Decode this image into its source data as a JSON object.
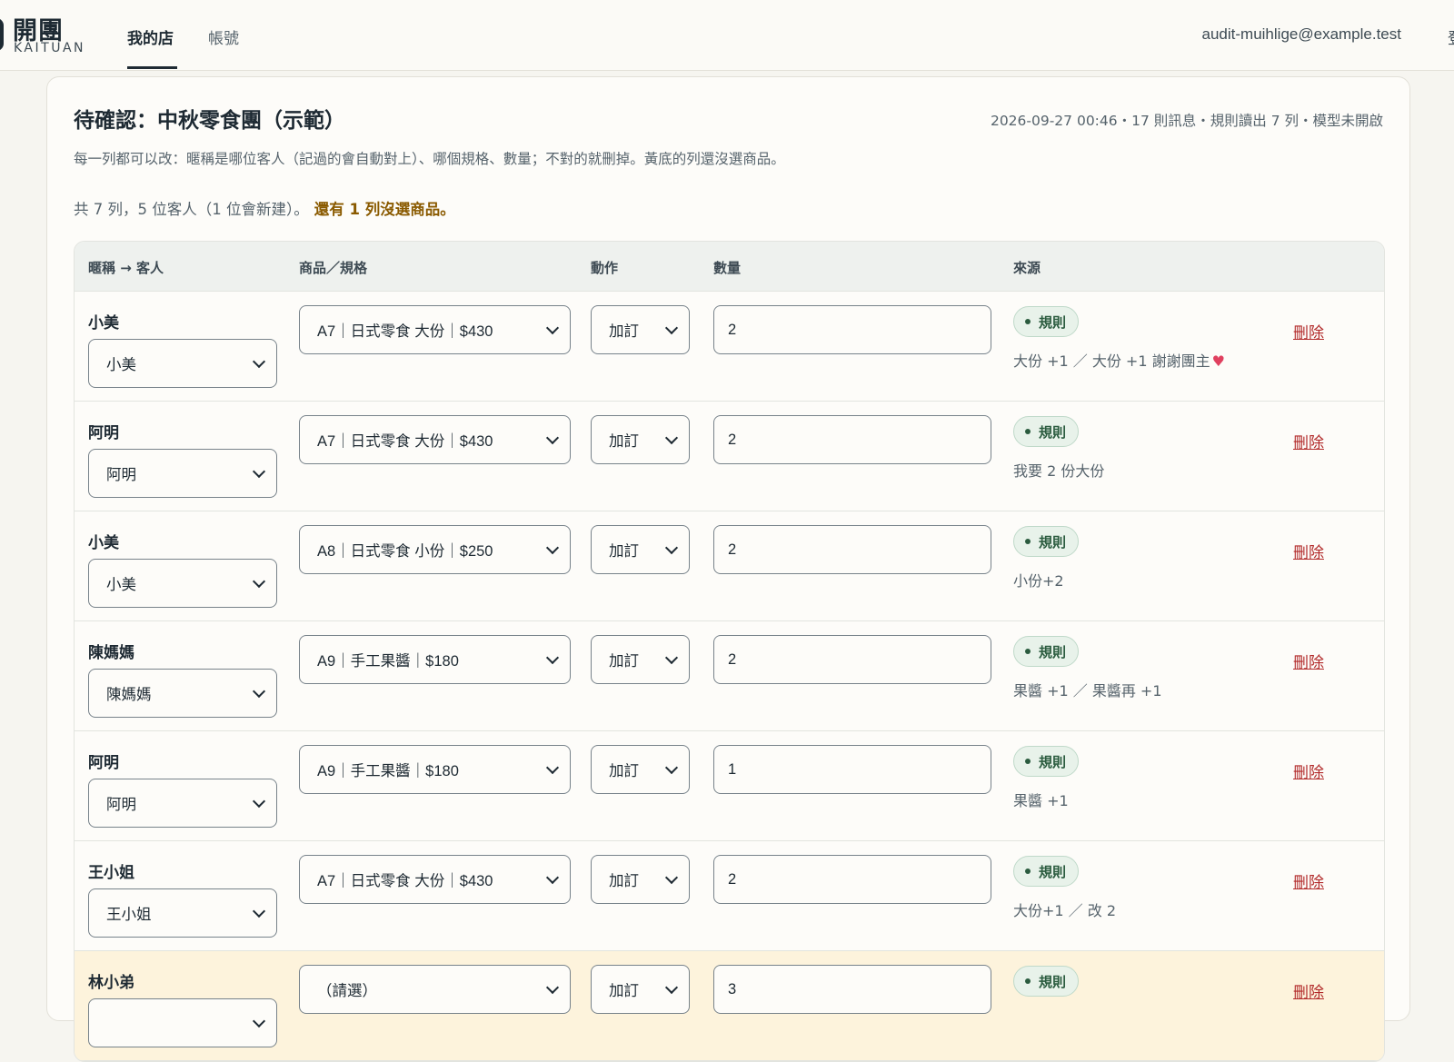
{
  "app": {
    "logo_title": "開團",
    "logo_subtitle": "KAITUAN",
    "nav": [
      {
        "label": "我的店",
        "active": true
      },
      {
        "label": "帳號",
        "active": false
      }
    ],
    "user_email": "audit-muihlige@example.test",
    "user_email_overflow": "登"
  },
  "page": {
    "title": "待確認：中秋零食團（示範）",
    "meta": "2026-09-27 00:46・17 則訊息・規則讀出 7 列・模型未開啟",
    "description": "每一列都可以改：暱稱是哪位客人（記過的會自動對上）、哪個規格、數量；不對的就刪掉。黃底的列還沒選商品。",
    "summary": "共 7 列，5 位客人（1 位會新建）。",
    "summary_warning": "還有 1 列沒選商品。"
  },
  "table": {
    "headers": {
      "nickname": "暱稱 → 客人",
      "product": "商品／規格",
      "action": "動作",
      "quantity": "數量",
      "source": "來源"
    },
    "rows": [
      {
        "nickname": "小美",
        "customer": "小美",
        "product": "A7｜日式零食 大份｜$430",
        "action": "加訂",
        "quantity": "2",
        "badge": "規則",
        "source": "大份 +1 ／ 大份 +1 謝謝團主",
        "heart": "♥",
        "delete": "刪除",
        "warning": false
      },
      {
        "nickname": "阿明",
        "customer": "阿明",
        "product": "A7｜日式零食 大份｜$430",
        "action": "加訂",
        "quantity": "2",
        "badge": "規則",
        "source": "我要 2 份大份",
        "heart": "",
        "delete": "刪除",
        "warning": false
      },
      {
        "nickname": "小美",
        "customer": "小美",
        "product": "A8｜日式零食 小份｜$250",
        "action": "加訂",
        "quantity": "2",
        "badge": "規則",
        "source": "小份+2",
        "heart": "",
        "delete": "刪除",
        "warning": false
      },
      {
        "nickname": "陳媽媽",
        "customer": "陳媽媽",
        "product": "A9｜手工果醬｜$180",
        "action": "加訂",
        "quantity": "2",
        "badge": "規則",
        "source": "果醬 +1 ／ 果醬再 +1",
        "heart": "",
        "delete": "刪除",
        "warning": false
      },
      {
        "nickname": "阿明",
        "customer": "阿明",
        "product": "A9｜手工果醬｜$180",
        "action": "加訂",
        "quantity": "1",
        "badge": "規則",
        "source": "果醬 +1",
        "heart": "",
        "delete": "刪除",
        "warning": false
      },
      {
        "nickname": "王小姐",
        "customer": "王小姐",
        "product": "A7｜日式零食 大份｜$430",
        "action": "加訂",
        "quantity": "2",
        "badge": "規則",
        "source": "大份+1 ／ 改 2",
        "heart": "",
        "delete": "刪除",
        "warning": false
      },
      {
        "nickname": "林小弟",
        "customer": "",
        "product": "（請選）",
        "action": "加訂",
        "quantity": "3",
        "badge": "規則",
        "source": "",
        "heart": "",
        "delete": "刪除",
        "warning": true
      }
    ]
  },
  "colors": {
    "warning_row_bg": "#fdf3dc",
    "warning_text": "#8a5a00",
    "badge_bg": "#e8f2ea",
    "delete_link": "#b22a2a",
    "heart": "#e0405f"
  }
}
